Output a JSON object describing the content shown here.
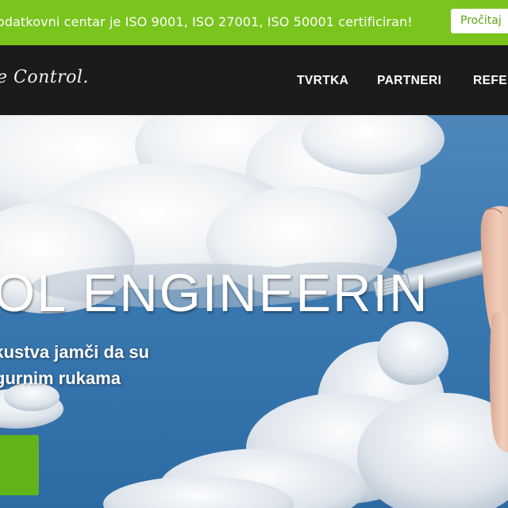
{
  "topbar": {
    "text": "odatkovni centar je ISO 9001, ISO 27001, ISO 50001 certificiran!",
    "button_label": "Pročitaj",
    "bg_color": "#7ac41e"
  },
  "navbar": {
    "logo_text": "e Control.",
    "items": [
      {
        "label": "TVRTKA"
      },
      {
        "label": "PARTNERI"
      },
      {
        "label": "REFE"
      }
    ],
    "bg_color": "#1b1b1b"
  },
  "hero": {
    "title": "OL ENGINEERIN",
    "subtitle_line1": "iskustva jamči da su",
    "subtitle_line2": "gurnim rukama",
    "cta_color": "#62b21a",
    "background": "sky-with-clouds-and-hand-holding-network-cable"
  }
}
